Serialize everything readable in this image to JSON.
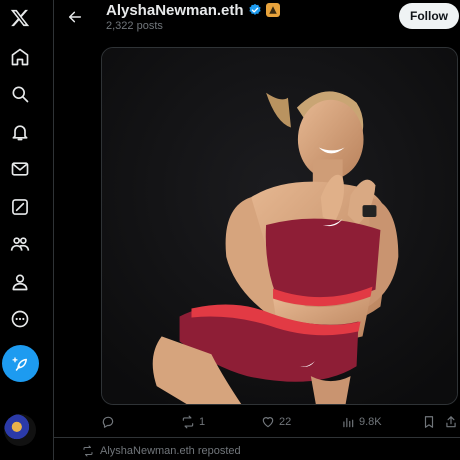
{
  "header": {
    "display_name": "AlyshaNewman.eth",
    "post_count": "2,322 posts",
    "follow_label": "Follow"
  },
  "nav": {
    "items": [
      "x-logo",
      "home",
      "explore",
      "notifications",
      "messages",
      "grok",
      "communities",
      "profile",
      "more"
    ]
  },
  "post": {
    "media_alt": "Photo",
    "actions": {
      "replies": "",
      "reposts": "1",
      "likes": "22",
      "views": "9.8K"
    }
  },
  "repost_banner": {
    "text": "AlyshaNewman.eth reposted"
  },
  "colors": {
    "background": "#000000",
    "accent": "#1d9bf0",
    "muted": "#71767b",
    "verified": "#1d9bf0",
    "affiliate_badge": "#e8a33c"
  }
}
